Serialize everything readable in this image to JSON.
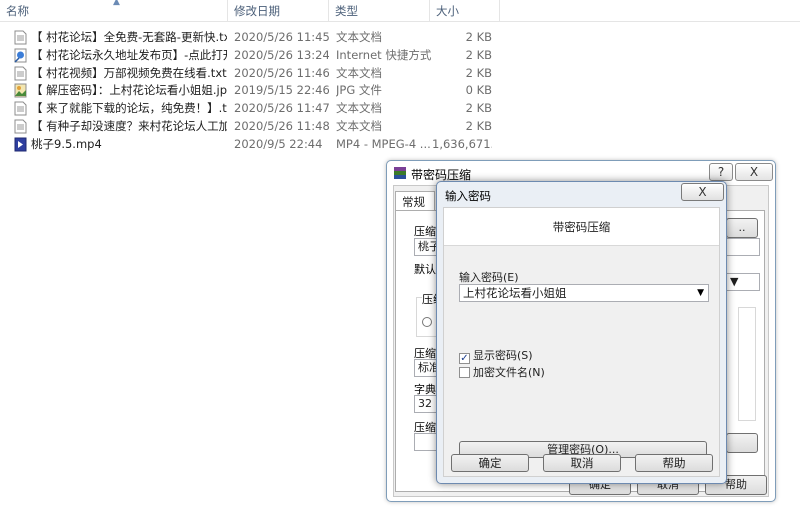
{
  "explorer": {
    "columns": [
      "名称",
      "修改日期",
      "类型",
      "大小"
    ],
    "files": [
      {
        "name": "【 村花论坛】全免费-无套路-更新快.txt",
        "date": "2020/5/26 11:45",
        "type": "文本文档",
        "size": "2 KB",
        "icon": "text-file-icon"
      },
      {
        "name": "【 村花论坛永久地址发布页】-点此打开",
        "date": "2020/5/26 13:24",
        "type": "Internet 快捷方式",
        "size": "2 KB",
        "icon": "shortcut-icon"
      },
      {
        "name": "【 村花视频】万部视频免费在线看.txt",
        "date": "2020/5/26 11:46",
        "type": "文本文档",
        "size": "2 KB",
        "icon": "text-file-icon"
      },
      {
        "name": "【 解压密码】：上村花论坛看小姐姐.jpg",
        "date": "2019/5/15 22:46",
        "type": "JPG 文件",
        "size": "0 KB",
        "icon": "image-file-icon"
      },
      {
        "name": "【 来了就能下载的论坛，纯免费！】.txt",
        "date": "2020/5/26 11:47",
        "type": "文本文档",
        "size": "2 KB",
        "icon": "text-file-icon"
      },
      {
        "name": "【 有种子却没速度？来村花论坛人工加...",
        "date": "2020/5/26 11:48",
        "type": "文本文档",
        "size": "2 KB",
        "icon": "text-file-icon"
      },
      {
        "name": "桃子9.5.mp4",
        "date": "2020/9/5 22:44",
        "type": "MP4 - MPEG-4 ...",
        "size": "1,636,671...",
        "icon": "video-file-icon"
      }
    ]
  },
  "back_dialog": {
    "title": "带密码压缩",
    "help_button": "?",
    "close_button": "X",
    "tab_general": "常规",
    "label_archive": "压缩文",
    "archive_value": "桃子",
    "label_default": "默认配",
    "label_compress_group": "压缩",
    "label_format": "压缩方",
    "format_value": "标准",
    "label_dict": "字典大",
    "dict_value": "32 M",
    "label_split": "压缩为",
    "ok_button": "确定",
    "cancel_button": "取消",
    "help_text_button": "帮助"
  },
  "password_dialog": {
    "title": "输入密码",
    "close_button": "X",
    "header": "带密码压缩",
    "password_label": "输入密码(E)",
    "password_value": "上村花论坛看小姐姐",
    "show_password_label": "显示密码(S)",
    "show_password_checked": true,
    "encrypt_names_label": "加密文件名(N)",
    "encrypt_names_checked": false,
    "manage_button": "管理密码(O)...",
    "ok_button": "确定",
    "cancel_button": "取消",
    "help_button": "帮助"
  }
}
